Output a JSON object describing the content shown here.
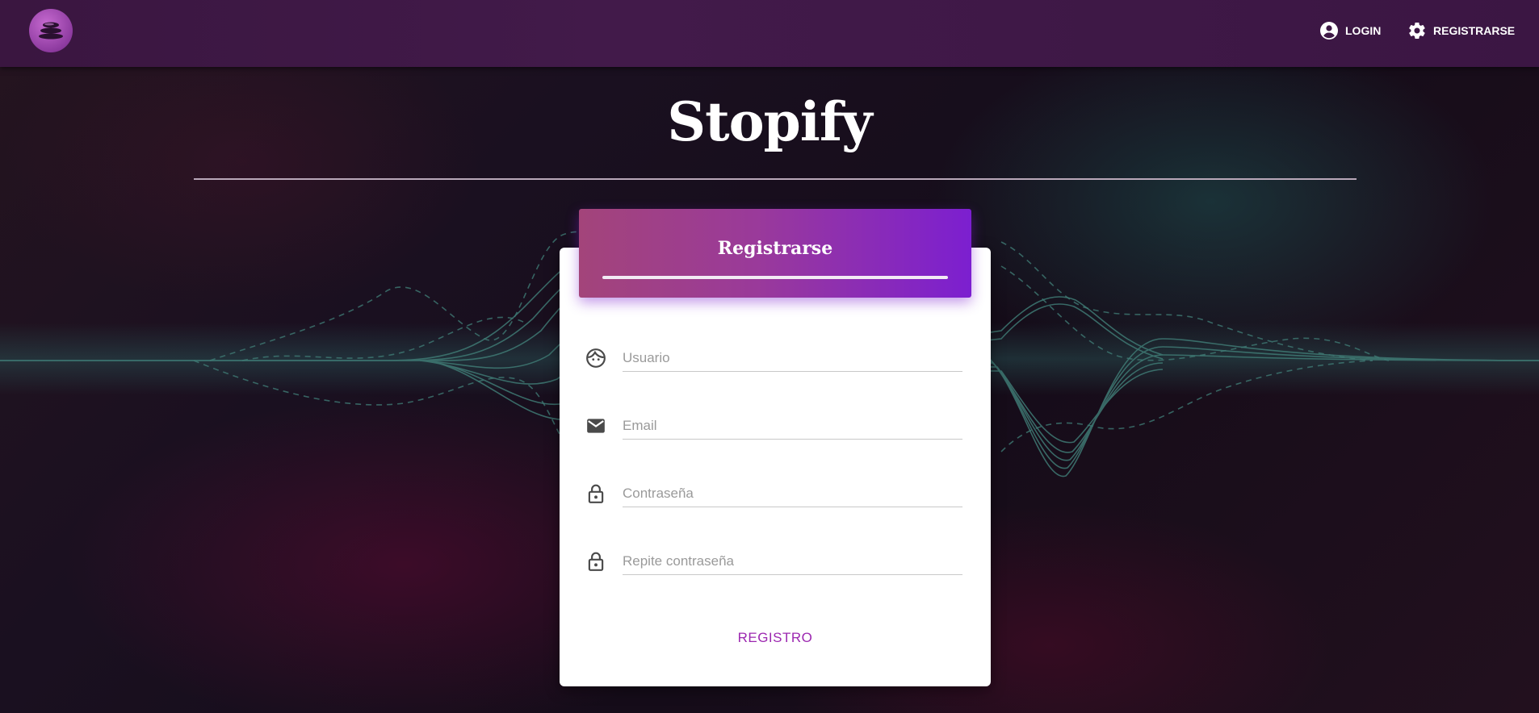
{
  "app": {
    "title": "Stopify"
  },
  "nav": {
    "login_label": "LOGIN",
    "register_label": "REGISTRARSE"
  },
  "form": {
    "header_title": "Registrarse",
    "fields": [
      {
        "icon": "face-icon",
        "placeholder": "Usuario",
        "value": ""
      },
      {
        "icon": "mail-icon",
        "placeholder": "Email",
        "value": ""
      },
      {
        "icon": "lock-icon",
        "placeholder": "Contraseña",
        "value": ""
      },
      {
        "icon": "lock-icon",
        "placeholder": "Repite contraseña",
        "value": ""
      }
    ],
    "submit_label": "REGISTRO"
  },
  "colors": {
    "topbar": "#3e1846",
    "accent": "#9c27b0",
    "header_gradient_start": "#a3447a",
    "header_gradient_end": "#7c1fd0",
    "wave": "#3f7a74"
  }
}
